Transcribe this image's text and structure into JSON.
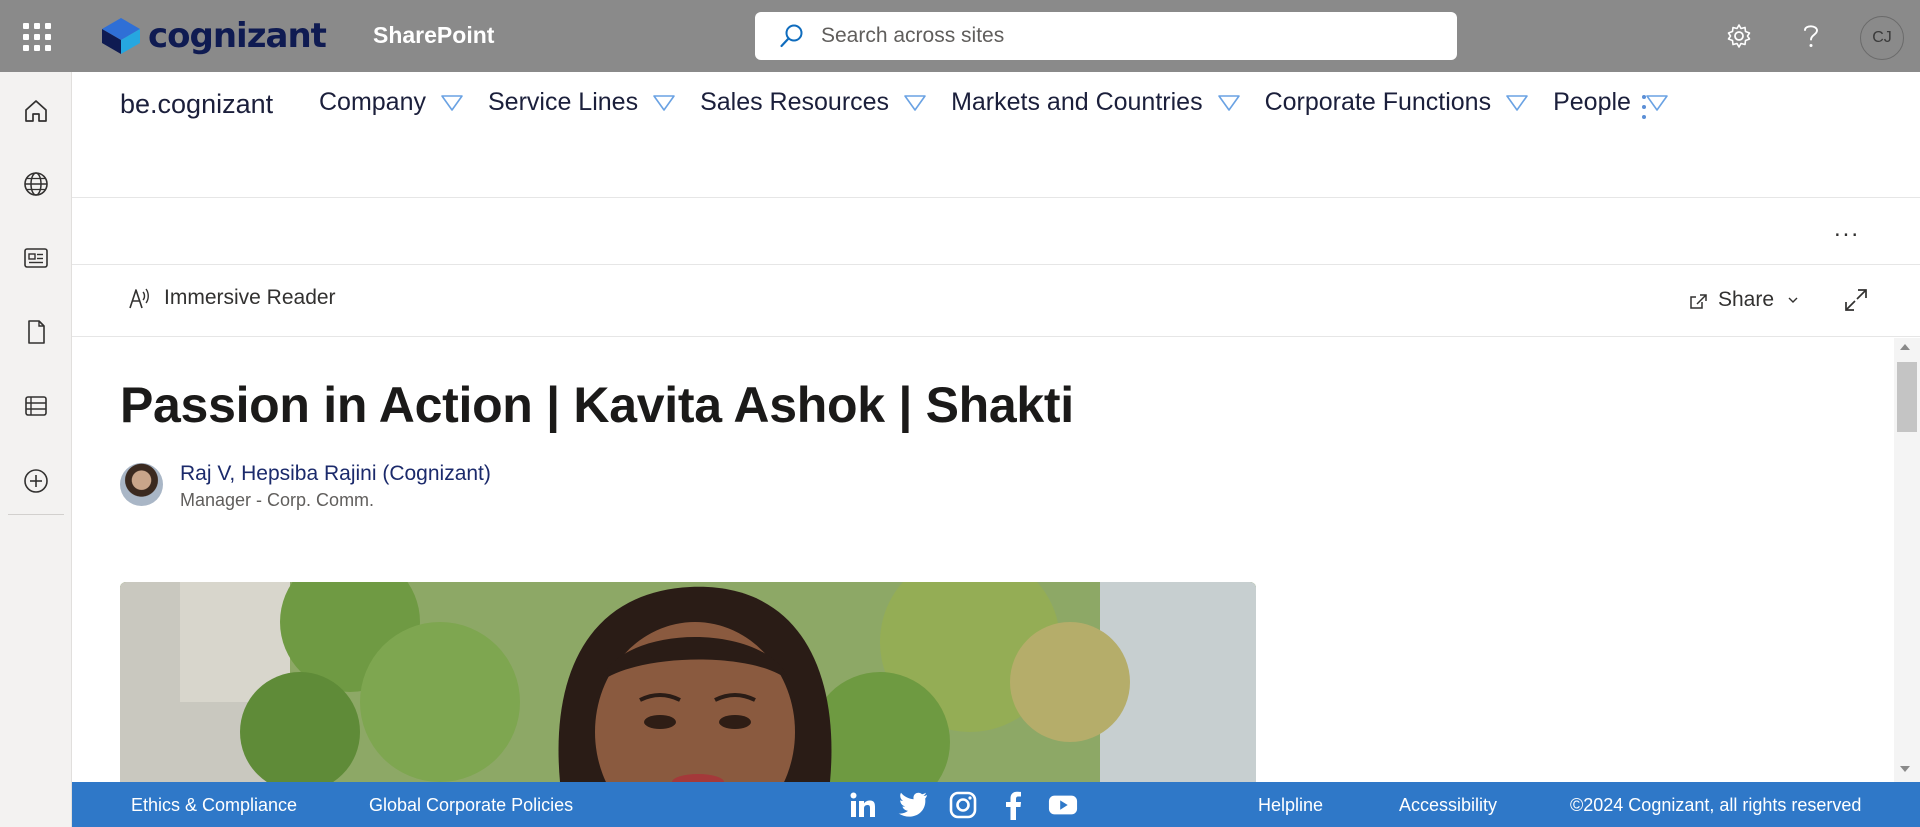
{
  "suitebar": {
    "logo_text": "cognizant",
    "app_name": "SharePoint",
    "search_placeholder": "Search across sites",
    "user_initials": "CJ",
    "icons": [
      "app-launcher-icon",
      "search-icon",
      "settings-icon",
      "help-icon"
    ]
  },
  "leftrail": {
    "items": [
      "home-icon",
      "globe-icon",
      "news-icon",
      "document-icon",
      "list-icon",
      "add-icon"
    ]
  },
  "site": {
    "name": "be.cognizant",
    "nav": [
      {
        "label": "Company"
      },
      {
        "label": "Service Lines"
      },
      {
        "label": "Sales Resources"
      },
      {
        "label": "Markets and Countries"
      },
      {
        "label": "Corporate Functions"
      },
      {
        "label": "People"
      }
    ]
  },
  "page_more": "...",
  "commandbar": {
    "immersive_reader": "Immersive Reader",
    "share": "Share"
  },
  "article": {
    "title": "Passion in Action | Kavita Ashok | Shakti",
    "author_name": "Raj V, Hepsiba Rajini (Cognizant)",
    "author_role": "Manager - Corp. Comm."
  },
  "footer": {
    "ethics": "Ethics & Compliance",
    "policies": "Global Corporate Policies",
    "helpline": "Helpline",
    "accessibility": "Accessibility",
    "copyright": "©2024 Cognizant, all rights reserved",
    "social": [
      "linkedin-icon",
      "twitter-icon",
      "instagram-icon",
      "facebook-icon",
      "youtube-icon"
    ]
  },
  "colors": {
    "suitebar_bg": "#8a8a8a",
    "footer_bg": "#2f78c8",
    "nav_text": "#1b1f3b",
    "brand_navy": "#0f1b52"
  }
}
